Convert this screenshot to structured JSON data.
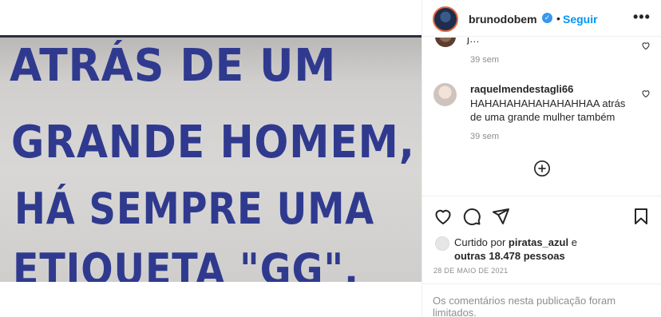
{
  "image": {
    "lines": [
      "ATRÁS DE UM",
      "GRANDE HOMEM,",
      "HÁ SEMPRE UMA",
      "ETIQUETA \"GG\"."
    ]
  },
  "header": {
    "username": "brunodobem",
    "separator": "•",
    "follow_label": "Seguir",
    "more_icon": "more-icon"
  },
  "comments": {
    "partial_text": "j…",
    "time1": "39 sem",
    "comment2": {
      "username": "raquelmendestagli66",
      "text": "HAHAHAHAHAHAHAHHAA atrás de uma grande mulher também",
      "time": "39 sem"
    },
    "load_more_icon": "plus-circle-icon"
  },
  "actions": {
    "like_icon": "heart-icon",
    "comment_icon": "comment-icon",
    "share_icon": "send-icon",
    "save_icon": "bookmark-icon"
  },
  "likes": {
    "prefix": "Curtido por ",
    "user": "piratas_azul",
    "middle": " e",
    "others": "outras 18.478 pessoas"
  },
  "date": "28 DE MAIO DE 2021",
  "comments_limited": "Os comentários nesta publicação foram limitados.",
  "colors": {
    "accent": "#0095f6",
    "verified": "#3897f0",
    "text": "#262626",
    "muted": "#8e8e8e",
    "image_text": "#2f3a8f"
  }
}
